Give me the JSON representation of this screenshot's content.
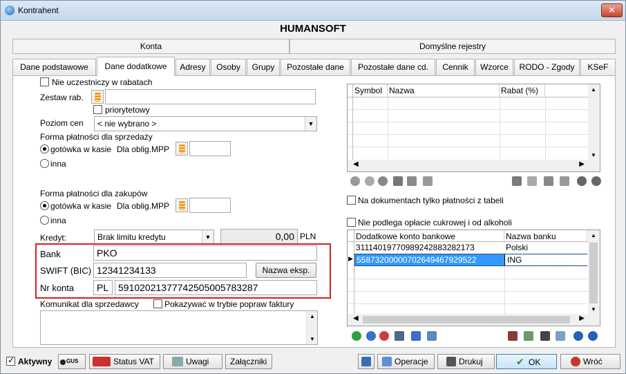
{
  "window": {
    "title": "Kontrahent",
    "close_label": "✕"
  },
  "company": "HUMANSOFT",
  "top_tabs": [
    "Konta",
    "Domyślne rejestry"
  ],
  "tabs": [
    "Dane podstawowe",
    "Dane dodatkowe",
    "Adresy",
    "Osoby",
    "Grupy",
    "Pozostałe dane",
    "Pozostałe dane cd.",
    "Cennik",
    "Wzorce",
    "RODO - Zgody",
    "KSeF"
  ],
  "active_tab": "Dane dodatkowe",
  "left": {
    "nie_uczestniczy": "Nie uczestniczy w rabatach",
    "zestaw_rab": "Zestaw rab.",
    "priorytetowy": "priorytetowy",
    "poziom_cen": "Poziom cen",
    "poziom_cen_value": "< nie wybrano >",
    "forma_sprzedazy": "Forma płatności dla sprzedaży",
    "gotowka": "gotówka w kasie",
    "dla_oblig": "Dla oblig.MPP",
    "inna": "inna",
    "forma_zakupow": "Forma płatności dla zakupów",
    "kredyt": "Kredyt:",
    "kredyt_value": "Brak limitu kredytu",
    "kredyt_amount": "0,00",
    "currency": "PLN",
    "bank_label": "Bank",
    "bank_value": "PKO",
    "swift_label": "SWIFT (BIC)",
    "swift_value": "12341234133",
    "nazwa_eksp": "Nazwa eksp.",
    "nr_konta_label": "Nr konta",
    "nr_konta_prefix": "PL",
    "nr_konta_value": "59102021377742505005783287",
    "komunikat": "Komunikat dla sprzedawcy",
    "pokazywac": "Pokazywać w trybie popraw faktury"
  },
  "rabat_grid": {
    "headers": [
      "Symbol",
      "Nazwa",
      "Rabat (%)"
    ]
  },
  "right": {
    "tylko_platnosci": "Na dokumentach tylko płatności z tabeli",
    "cukrowa": "Nie podlega opłacie cukrowej i od alkoholi"
  },
  "bank_grid": {
    "headers": [
      "Dodatkowe konto bankowe",
      "Nazwa banku"
    ],
    "rows": [
      {
        "account": "31114019770989242883282173",
        "bank": "Polski"
      },
      {
        "account": "55873200000702649467929522",
        "bank": "ING"
      }
    ]
  },
  "bottom": {
    "aktywny": "Aktywny",
    "gus": "GUS",
    "status_vat": "Status VAT",
    "uwagi": "Uwagi",
    "zalaczniki": "Załączniki",
    "operacje": "Operacje",
    "drukuj": "Drukuj",
    "ok": "OK",
    "wroc": "Wróć"
  }
}
